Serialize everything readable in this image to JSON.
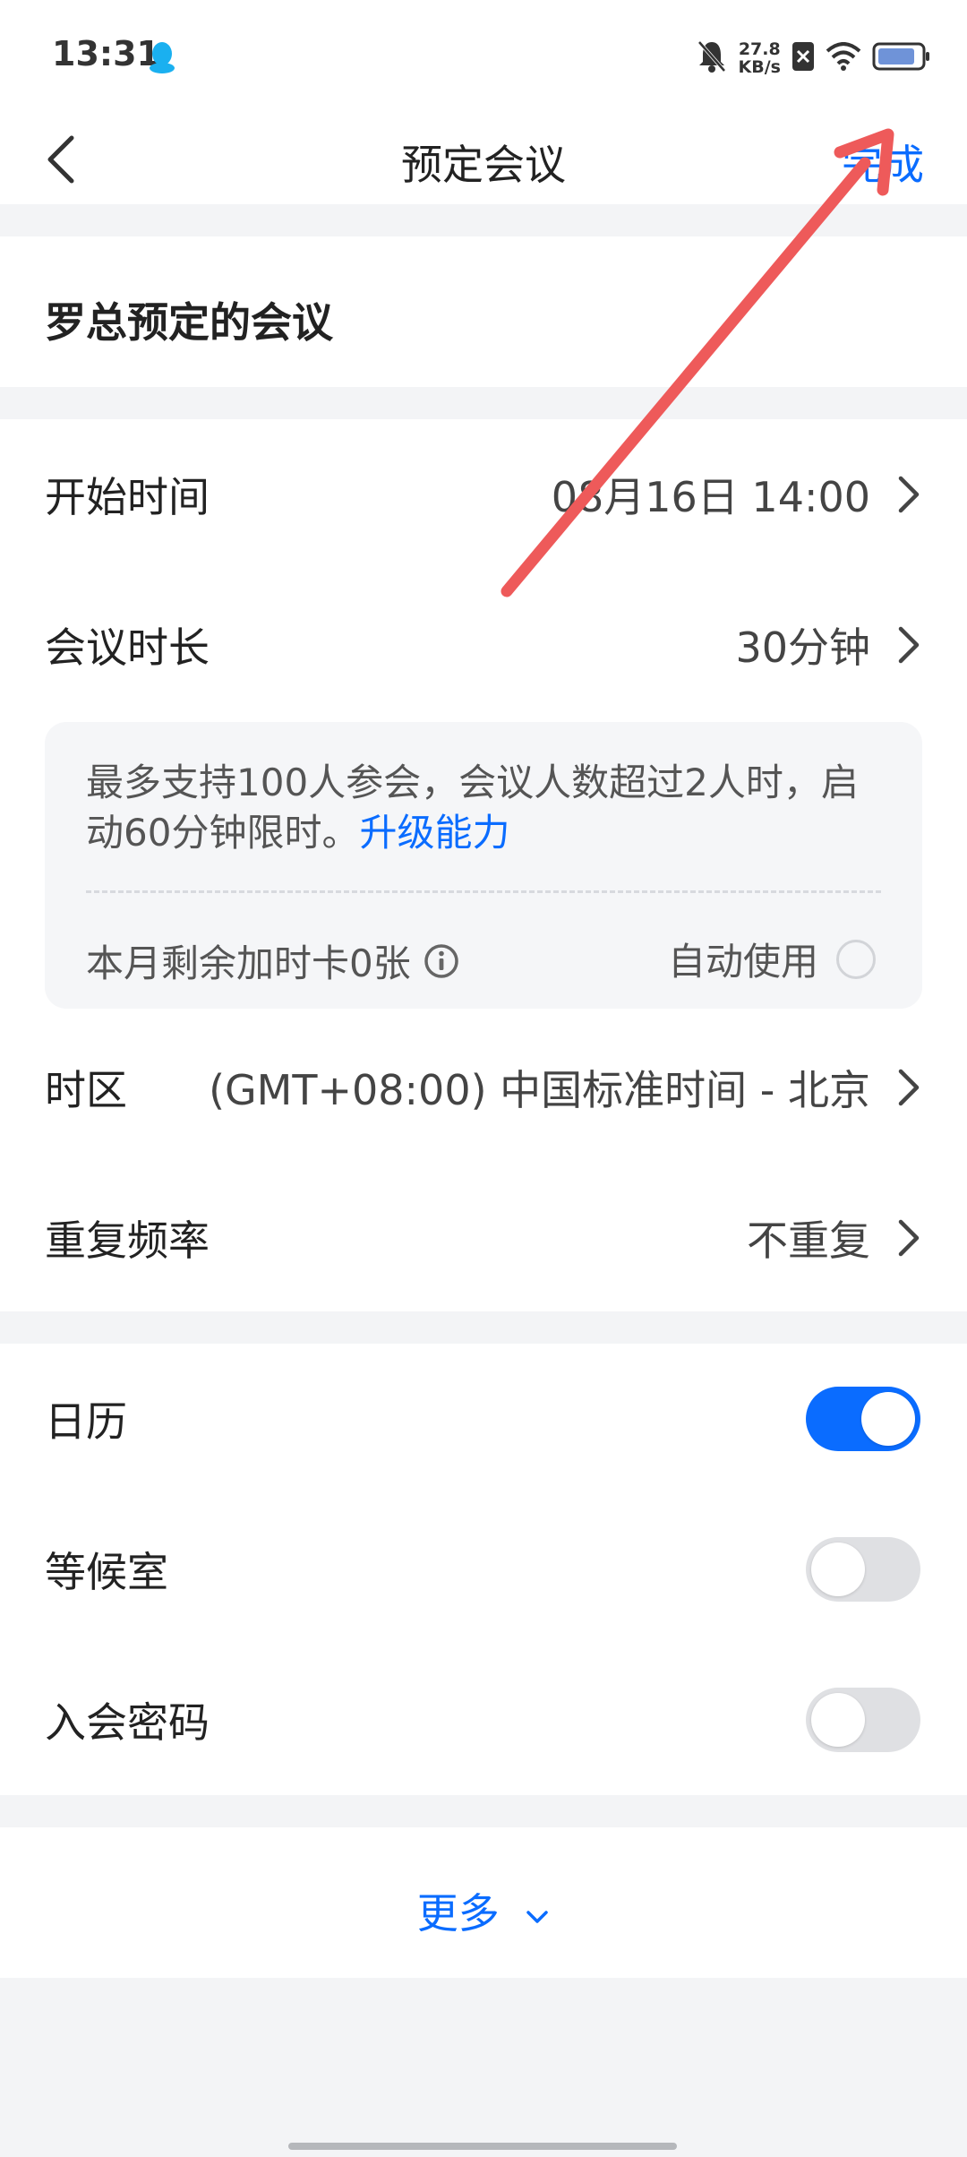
{
  "status_bar": {
    "time": "13:31",
    "net_speed_value": "27.8",
    "net_speed_unit": "KB/s"
  },
  "nav": {
    "title": "预定会议",
    "done_label": "完成"
  },
  "meeting": {
    "name": "罗总预定的会议"
  },
  "schedule": {
    "start_time_label": "开始时间",
    "start_time_value": "08月16日 14:00",
    "duration_label": "会议时长",
    "duration_value": "30分钟",
    "limit_text": "最多支持100人参会，会议人数超过2人时，启动60分钟限时。",
    "upgrade_link": "升级能力",
    "time_card_text": "本月剩余加时卡0张",
    "auto_use_label": "自动使用",
    "timezone_label": "时区",
    "timezone_value": "(GMT+08:00) 中国标准时间 - 北京",
    "repeat_label": "重复频率",
    "repeat_value": "不重复"
  },
  "settings": {
    "calendar_label": "日历",
    "calendar_on": true,
    "waiting_room_label": "等候室",
    "waiting_room_on": false,
    "password_label": "入会密码",
    "password_on": false
  },
  "more": {
    "label": "更多"
  },
  "colors": {
    "accent": "#0a6cff",
    "annotation_arrow": "#ee5a5a",
    "background": "#f3f4f6"
  }
}
